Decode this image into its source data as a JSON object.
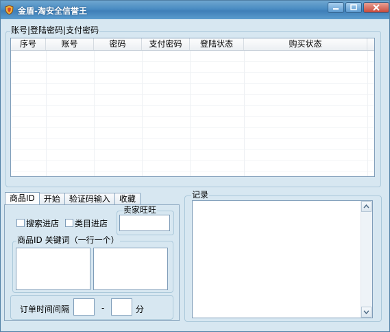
{
  "window": {
    "title": "金盾-淘安全信誉王",
    "colors": {
      "titlebar": "#4a8cc2",
      "background": "#d7e7f1",
      "border": "#7f9db9"
    }
  },
  "accounts_group": {
    "label": "账号|登陆密码|支付密码",
    "columns": [
      "序号",
      "账号",
      "密码",
      "支付密码",
      "登陆状态",
      "购买状态"
    ]
  },
  "tabs": [
    {
      "label": "商品ID",
      "active": true
    },
    {
      "label": "开始",
      "active": false
    },
    {
      "label": "验证码输入",
      "active": false
    },
    {
      "label": "收藏",
      "active": false
    }
  ],
  "product_tab": {
    "search_store_label": "搜索进店",
    "category_store_label": "类目进店",
    "seller_wangwang_label": "卖家旺旺",
    "seller_wangwang_value": "",
    "product_id_group_label": "商品ID   关键词（一行一个）",
    "product_ids_value": "",
    "keywords_value": "",
    "order_interval_label": "订单时间间隔",
    "interval_from": "",
    "interval_separator": "-",
    "interval_to": "",
    "interval_unit": "分"
  },
  "log_group": {
    "label": "记录",
    "value": ""
  }
}
